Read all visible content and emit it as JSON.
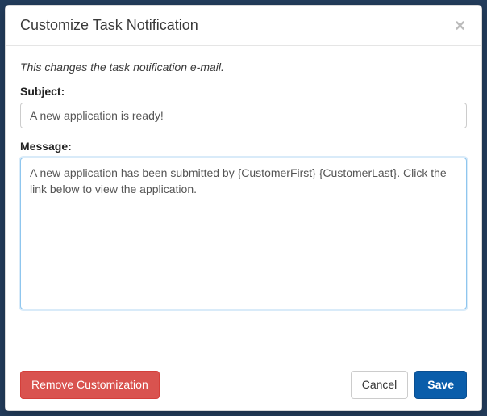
{
  "modal": {
    "title": "Customize Task Notification",
    "intro": "This changes the task notification e-mail.",
    "subject_label": "Subject:",
    "subject_value": "A new application is ready!",
    "message_label": "Message:",
    "message_value": "A new application has been submitted by {CustomerFirst} {CustomerLast}. Click the link below to view the application."
  },
  "buttons": {
    "remove": "Remove Customization",
    "cancel": "Cancel",
    "save": "Save"
  }
}
